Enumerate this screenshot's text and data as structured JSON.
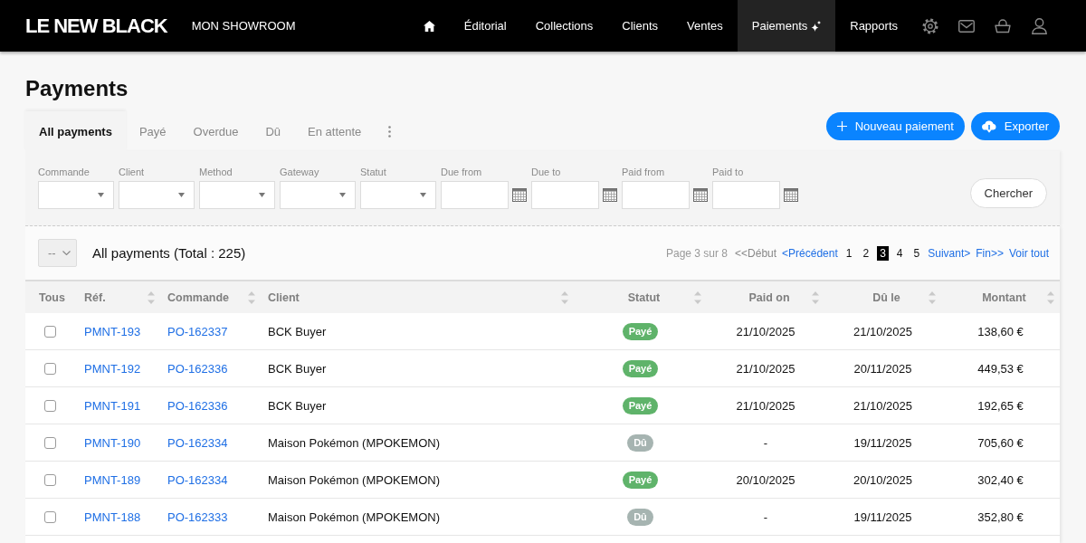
{
  "header": {
    "logo": "LE NEW BLACK",
    "showroom": "MON SHOWROOM",
    "nav": [
      {
        "label": "Éditorial",
        "selected": false,
        "new": false
      },
      {
        "label": "Collections",
        "selected": false,
        "new": false
      },
      {
        "label": "Clients",
        "selected": false,
        "new": false
      },
      {
        "label": "Ventes",
        "selected": false,
        "new": false
      },
      {
        "label": "Paiements",
        "selected": true,
        "new": true
      },
      {
        "label": "Rapports",
        "selected": false,
        "new": false
      }
    ]
  },
  "page": {
    "title": "Payments"
  },
  "tabs": [
    {
      "label": "All payments",
      "selected": true
    },
    {
      "label": "Payé",
      "selected": false
    },
    {
      "label": "Overdue",
      "selected": false
    },
    {
      "label": "Dû",
      "selected": false
    },
    {
      "label": "En attente",
      "selected": false
    }
  ],
  "actions": [
    {
      "kind": "add",
      "label": "Nouveau paiement"
    },
    {
      "kind": "export",
      "label": "Exporter"
    }
  ],
  "filters": [
    {
      "kind": "select",
      "label": "Commande"
    },
    {
      "kind": "select",
      "label": "Client"
    },
    {
      "kind": "select",
      "label": "Method"
    },
    {
      "kind": "select",
      "label": "Gateway"
    },
    {
      "kind": "select",
      "label": "Statut"
    },
    {
      "kind": "date",
      "label": "Due from"
    },
    {
      "kind": "date",
      "label": "Due to"
    },
    {
      "kind": "date",
      "label": "Paid from"
    },
    {
      "kind": "date",
      "label": "Paid to"
    }
  ],
  "search_button": "Chercher",
  "list": {
    "bulk_action": "--",
    "title": "All payments (Total : 225)",
    "pagination": [
      {
        "kind": "info",
        "label": "Page 3 sur 8"
      },
      {
        "kind": "nav",
        "label": "<<Début",
        "disabled": true
      },
      {
        "kind": "nav",
        "label": "<Précédent",
        "disabled": false
      },
      {
        "kind": "page",
        "label": "1",
        "selected": false
      },
      {
        "kind": "page",
        "label": "2",
        "selected": false
      },
      {
        "kind": "page",
        "label": "3",
        "selected": true
      },
      {
        "kind": "page",
        "label": "4",
        "selected": false
      },
      {
        "kind": "page",
        "label": "5",
        "selected": false
      },
      {
        "kind": "nav",
        "label": "Suivant>",
        "disabled": false
      },
      {
        "kind": "nav",
        "label": "Fin>>",
        "disabled": false
      },
      {
        "kind": "nav",
        "label": "Voir tout",
        "disabled": false
      }
    ]
  },
  "table": {
    "columns": [
      {
        "label": "Tous",
        "sortable": false
      },
      {
        "label": "Réf.",
        "sortable": true
      },
      {
        "label": "Commande",
        "sortable": true
      },
      {
        "label": "Client",
        "sortable": true
      },
      {
        "label": "Statut",
        "sortable": true
      },
      {
        "label": "Paid on",
        "sortable": true
      },
      {
        "label": "Dû le",
        "sortable": true
      },
      {
        "label": "Montant",
        "sortable": true
      }
    ],
    "rows": [
      {
        "checked": false,
        "ref": "PMNT-193",
        "order": "PO-162337",
        "client": "BCK Buyer",
        "status": {
          "label": "Payé",
          "color": "#5fb36a"
        },
        "paid_on": "21/10/2025",
        "due": "21/10/2025",
        "amount": "138,60 €"
      },
      {
        "checked": false,
        "ref": "PMNT-192",
        "order": "PO-162336",
        "client": "BCK Buyer",
        "status": {
          "label": "Payé",
          "color": "#5fb36a"
        },
        "paid_on": "21/10/2025",
        "due": "20/11/2025",
        "amount": "449,53 €"
      },
      {
        "checked": false,
        "ref": "PMNT-191",
        "order": "PO-162336",
        "client": "BCK Buyer",
        "status": {
          "label": "Payé",
          "color": "#5fb36a"
        },
        "paid_on": "21/10/2025",
        "due": "21/10/2025",
        "amount": "192,65 €"
      },
      {
        "checked": false,
        "ref": "PMNT-190",
        "order": "PO-162334",
        "client": "Maison Pokémon (MPOKEMON)",
        "status": {
          "label": "Dû",
          "color": "#a6b4b1"
        },
        "paid_on": "-",
        "due": "19/11/2025",
        "amount": "705,60 €"
      },
      {
        "checked": false,
        "ref": "PMNT-189",
        "order": "PO-162334",
        "client": "Maison Pokémon (MPOKEMON)",
        "status": {
          "label": "Payé",
          "color": "#5fb36a"
        },
        "paid_on": "20/10/2025",
        "due": "20/10/2025",
        "amount": "302,40 €"
      },
      {
        "checked": false,
        "ref": "PMNT-188",
        "order": "PO-162333",
        "client": "Maison Pokémon (MPOKEMON)",
        "status": {
          "label": "Dû",
          "color": "#a6b4b1"
        },
        "paid_on": "-",
        "due": "19/11/2025",
        "amount": "352,80 €"
      }
    ]
  }
}
